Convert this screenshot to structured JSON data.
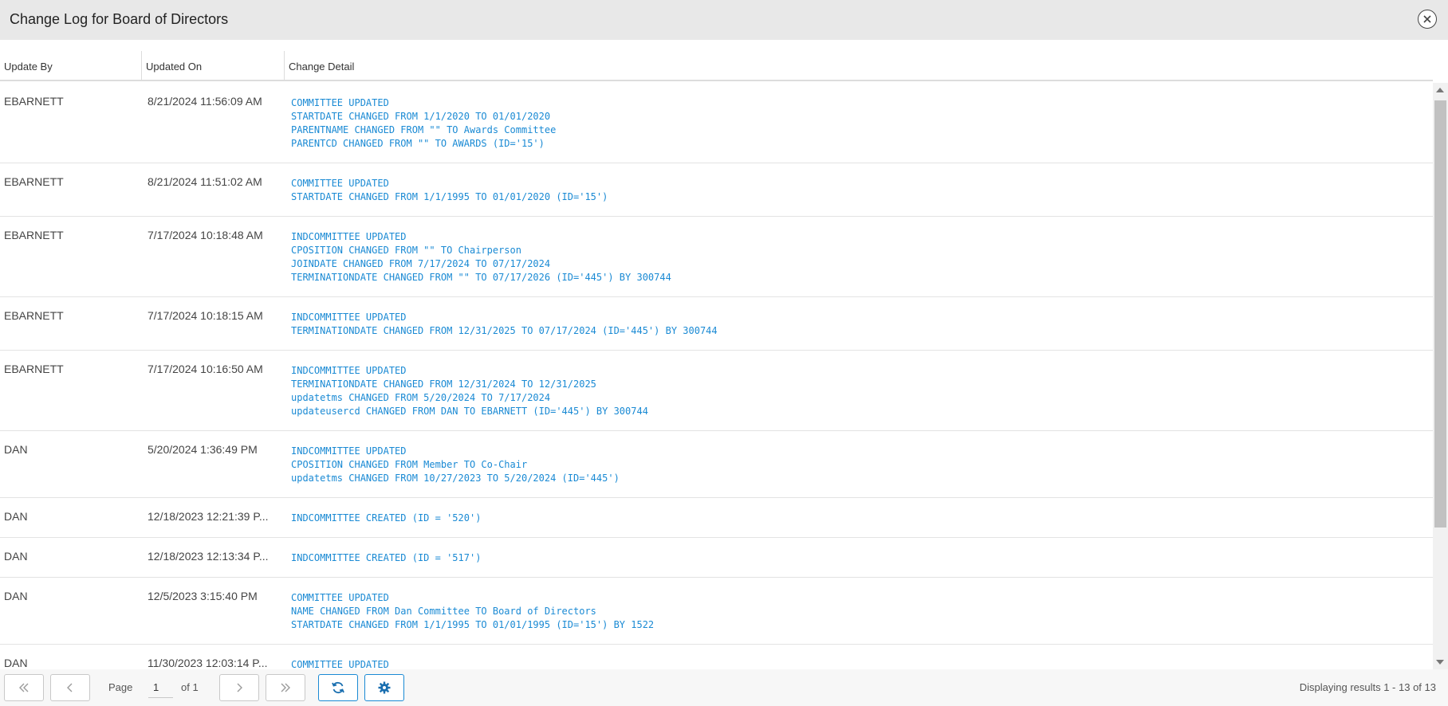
{
  "dialog": {
    "title": "Change Log for Board of Directors",
    "close_icon": "close-circle-icon"
  },
  "table": {
    "columns": [
      "Update By",
      "Updated On",
      "Change Detail"
    ],
    "rows": [
      {
        "user": "EBARNETT",
        "date": "8/21/2024 11:56:09 AM",
        "detail": "COMMITTEE UPDATED\nSTARTDATE CHANGED FROM 1/1/2020 TO 01/01/2020\nPARENTNAME CHANGED FROM \"\" TO Awards Committee\nPARENTCD CHANGED FROM \"\" TO AWARDS (ID='15')"
      },
      {
        "user": "EBARNETT",
        "date": "8/21/2024 11:51:02 AM",
        "detail": "COMMITTEE UPDATED\nSTARTDATE CHANGED FROM 1/1/1995 TO 01/01/2020 (ID='15')"
      },
      {
        "user": "EBARNETT",
        "date": "7/17/2024 10:18:48 AM",
        "detail": "INDCOMMITTEE UPDATED\nCPOSITION CHANGED FROM \"\" TO Chairperson\nJOINDATE CHANGED FROM 7/17/2024 TO 07/17/2024\nTERMINATIONDATE CHANGED FROM \"\" TO 07/17/2026 (ID='445') BY 300744"
      },
      {
        "user": "EBARNETT",
        "date": "7/17/2024 10:18:15 AM",
        "detail": "INDCOMMITTEE UPDATED\nTERMINATIONDATE CHANGED FROM 12/31/2025 TO 07/17/2024 (ID='445') BY 300744"
      },
      {
        "user": "EBARNETT",
        "date": "7/17/2024 10:16:50 AM",
        "detail": "INDCOMMITTEE UPDATED\nTERMINATIONDATE CHANGED FROM 12/31/2024 TO 12/31/2025\nupdatetms CHANGED FROM 5/20/2024 TO 7/17/2024\nupdateusercd CHANGED FROM DAN TO EBARNETT (ID='445') BY 300744"
      },
      {
        "user": "DAN",
        "date": "5/20/2024 1:36:49 PM",
        "detail": "INDCOMMITTEE UPDATED\nCPOSITION CHANGED FROM Member TO Co-Chair\nupdatetms CHANGED FROM 10/27/2023 TO 5/20/2024 (ID='445')"
      },
      {
        "user": "DAN",
        "date": "12/18/2023 12:21:39 P...",
        "detail": "INDCOMMITTEE CREATED (ID = '520')"
      },
      {
        "user": "DAN",
        "date": "12/18/2023 12:13:34 P...",
        "detail": "INDCOMMITTEE CREATED (ID = '517')"
      },
      {
        "user": "DAN",
        "date": "12/5/2023 3:15:40 PM",
        "detail": "COMMITTEE UPDATED\nNAME CHANGED FROM Dan Committee TO Board of Directors\nSTARTDATE CHANGED FROM 1/1/1995 TO 01/01/1995 (ID='15') BY 1522"
      },
      {
        "user": "DAN",
        "date": "11/30/2023 12:03:14 P...",
        "detail": "COMMITTEE UPDATED"
      }
    ]
  },
  "pager": {
    "first_icon": "double-chevron-left-icon",
    "prev_icon": "chevron-left-icon",
    "page_label": "Page",
    "page_value": "1",
    "of_label": "of 1",
    "next_icon": "chevron-right-icon",
    "last_icon": "double-chevron-right-icon",
    "refresh_icon": "refresh-icon",
    "settings_icon": "gear-icon",
    "displaying": "Displaying results 1 - 13 of 13"
  },
  "colors": {
    "detail_text": "#1a8ad4",
    "accent_button_border": "#1a8ad4",
    "titlebar_bg": "#e8e8e8"
  }
}
